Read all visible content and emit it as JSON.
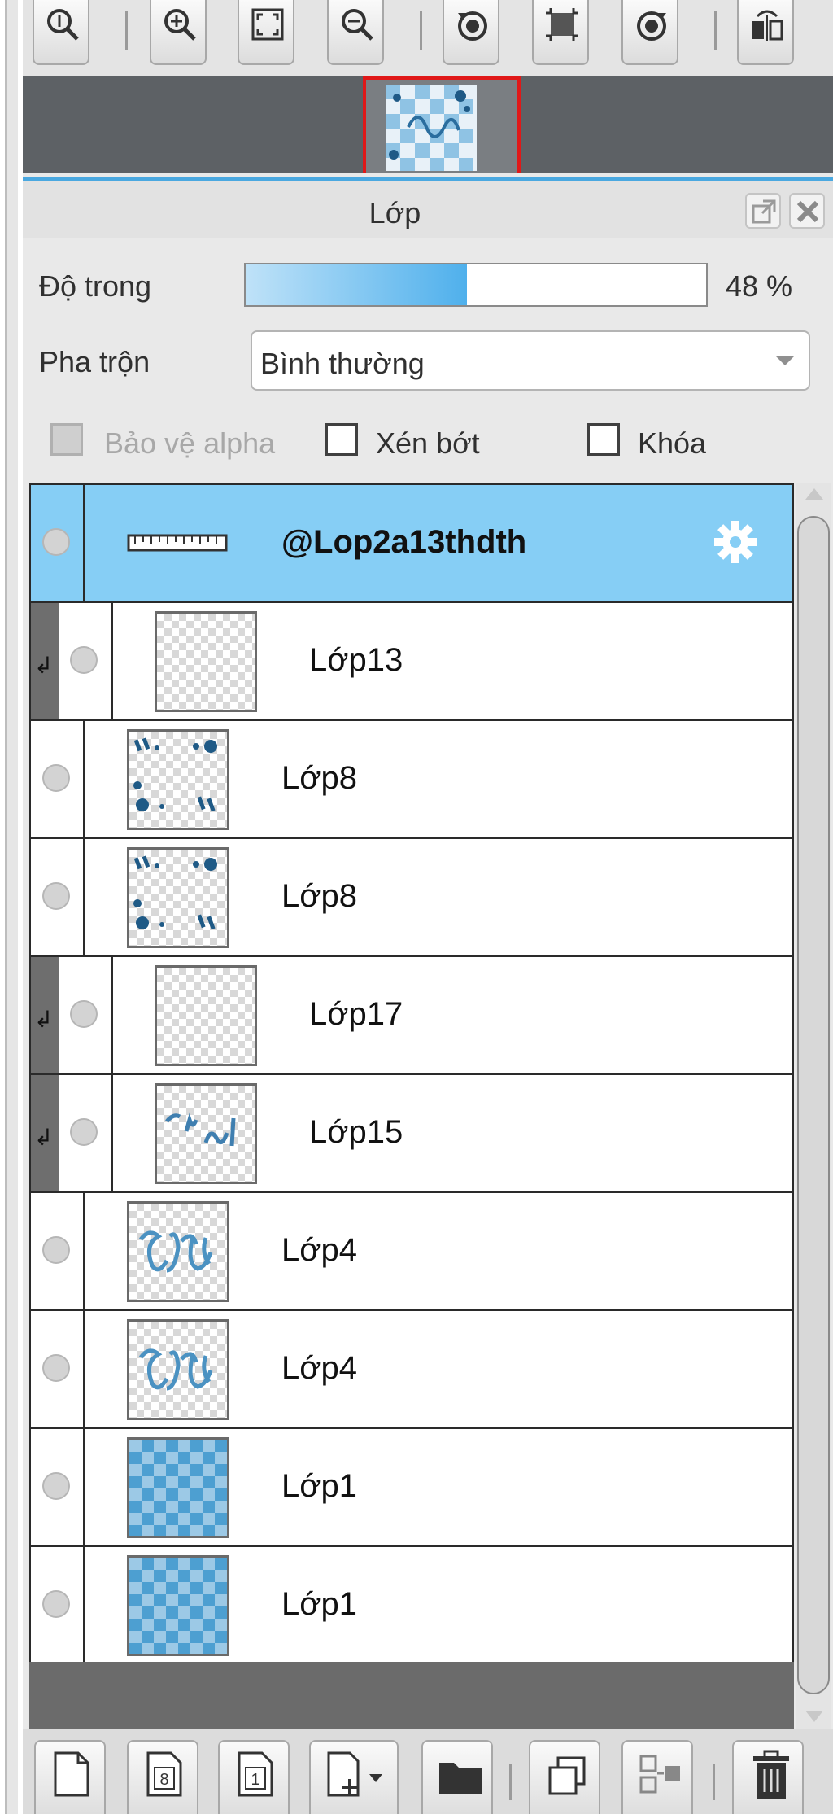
{
  "toolbar": {
    "buttons": [
      "zoom-actual-icon",
      "zoom-in-icon",
      "fit-screen-icon",
      "zoom-out-icon",
      "rotate-left-icon",
      "crop-icon",
      "rotate-right-icon",
      "flip-icon"
    ]
  },
  "panel": {
    "title": "Lớp",
    "opacity_label": "Độ trong",
    "opacity_value": "48 %",
    "opacity_fraction": 0.48,
    "blend_label": "Pha trộn",
    "blend_value": "Bình thường",
    "protect_alpha_label": "Bảo vệ alpha",
    "clip_label": "Xén bớt",
    "lock_label": "Khóa"
  },
  "layers": [
    {
      "name": "@Lop2a13thdth",
      "selected": true,
      "clipped": false,
      "thumb": "ruler",
      "gear": true
    },
    {
      "name": "Lớp13",
      "selected": false,
      "clipped": true,
      "thumb": "empty"
    },
    {
      "name": "Lớp8",
      "selected": false,
      "clipped": false,
      "thumb": "dots"
    },
    {
      "name": "Lớp8",
      "selected": false,
      "clipped": false,
      "thumb": "dots"
    },
    {
      "name": "Lớp17",
      "selected": false,
      "clipped": true,
      "thumb": "empty"
    },
    {
      "name": "Lớp15",
      "selected": false,
      "clipped": true,
      "thumb": "strokes"
    },
    {
      "name": "Lớp4",
      "selected": false,
      "clipped": false,
      "thumb": "script"
    },
    {
      "name": "Lớp4",
      "selected": false,
      "clipped": false,
      "thumb": "script"
    },
    {
      "name": "Lớp1",
      "selected": false,
      "clipped": false,
      "thumb": "checker"
    },
    {
      "name": "Lớp1",
      "selected": false,
      "clipped": false,
      "thumb": "checker"
    }
  ],
  "bottom_toolbar": {
    "new_layer_8bit_label": "8",
    "new_layer_1bit_label": "1",
    "buttons": [
      "new-layer-icon",
      "new-8bit-layer-icon",
      "new-1bit-layer-icon",
      "add-layer-menu-icon",
      "new-folder-icon",
      "duplicate-layer-icon",
      "merge-down-icon",
      "delete-layer-icon"
    ]
  },
  "colors": {
    "selected_layer": "#86cef5",
    "accent_line": "#4aa8e0",
    "nav_frame": "#e01818"
  }
}
